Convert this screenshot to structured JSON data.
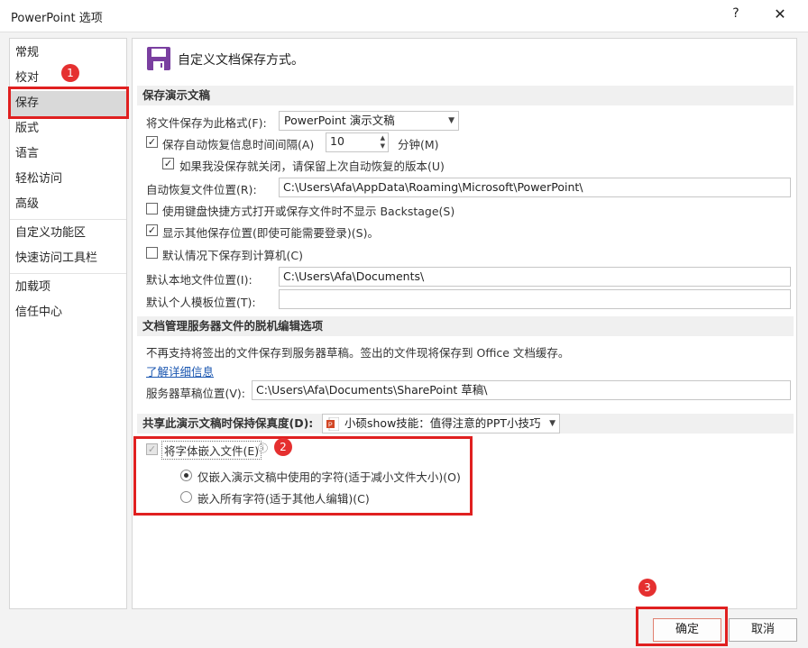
{
  "window": {
    "title": "PowerPoint 选项",
    "help": "?",
    "close": "✕"
  },
  "sidebar": {
    "items": [
      {
        "label": "常规"
      },
      {
        "label": "校对"
      },
      {
        "label": "保存"
      },
      {
        "label": "版式"
      },
      {
        "label": "语言"
      },
      {
        "label": "轻松访问"
      },
      {
        "label": "高级"
      },
      {
        "label": "自定义功能区"
      },
      {
        "label": "快速访问工具栏"
      },
      {
        "label": "加载项"
      },
      {
        "label": "信任中心"
      }
    ],
    "active": "保存"
  },
  "main": {
    "header": "自定义文档保存方式。",
    "save_section": {
      "title": "保存演示文稿",
      "format_label": "将文件保存为此格式(F):",
      "format_value": "PowerPoint 演示文稿",
      "autorecover_label": "保存自动恢复信息时间间隔(A)",
      "autorecover_value": "10",
      "autorecover_unit": "分钟(M)",
      "keep_last_label": "如果我没保存就关闭，请保留上次自动恢复的版本(U)",
      "autorecover_path_label": "自动恢复文件位置(R):",
      "autorecover_path_value": "C:\\Users\\Afa\\AppData\\Roaming\\Microsoft\\PowerPoint\\",
      "no_backstage_label": "使用键盘快捷方式打开或保存文件时不显示 Backstage(S)",
      "show_other_label": "显示其他保存位置(即使可能需要登录)(S)。",
      "save_to_computer_label": "默认情况下保存到计算机(C)",
      "default_local_label": "默认本地文件位置(I):",
      "default_local_value": "C:\\Users\\Afa\\Documents\\",
      "default_template_label": "默认个人模板位置(T):",
      "default_template_value": ""
    },
    "offline_section": {
      "title": "文档管理服务器文件的脱机编辑选项",
      "notice": "不再支持将签出的文件保存到服务器草稿。签出的文件现将保存到 Office 文档缓存。",
      "learn_more": "了解详细信息",
      "drafts_label": "服务器草稿位置(V):",
      "drafts_value": "C:\\Users\\Afa\\Documents\\SharePoint 草稿\\"
    },
    "fidelity_section": {
      "title": "共享此演示文稿时保持保真度(D):",
      "doc_value": "小硕show技能：值得注意的PPT小技巧",
      "embed_fonts_label": "将字体嵌入文件(E)",
      "info_icon": "ⓘ",
      "embed_used_label": "仅嵌入演示文稿中使用的字符(适于减小文件大小)(O)",
      "embed_all_label": "嵌入所有字符(适于其他人编辑)(C)"
    }
  },
  "annotations": {
    "badge1": "1",
    "badge2": "2",
    "badge3": "3",
    "color": "#e02020"
  },
  "footer": {
    "ok": "确定",
    "cancel": "取消"
  },
  "icons": {
    "checkmark": "✓"
  }
}
